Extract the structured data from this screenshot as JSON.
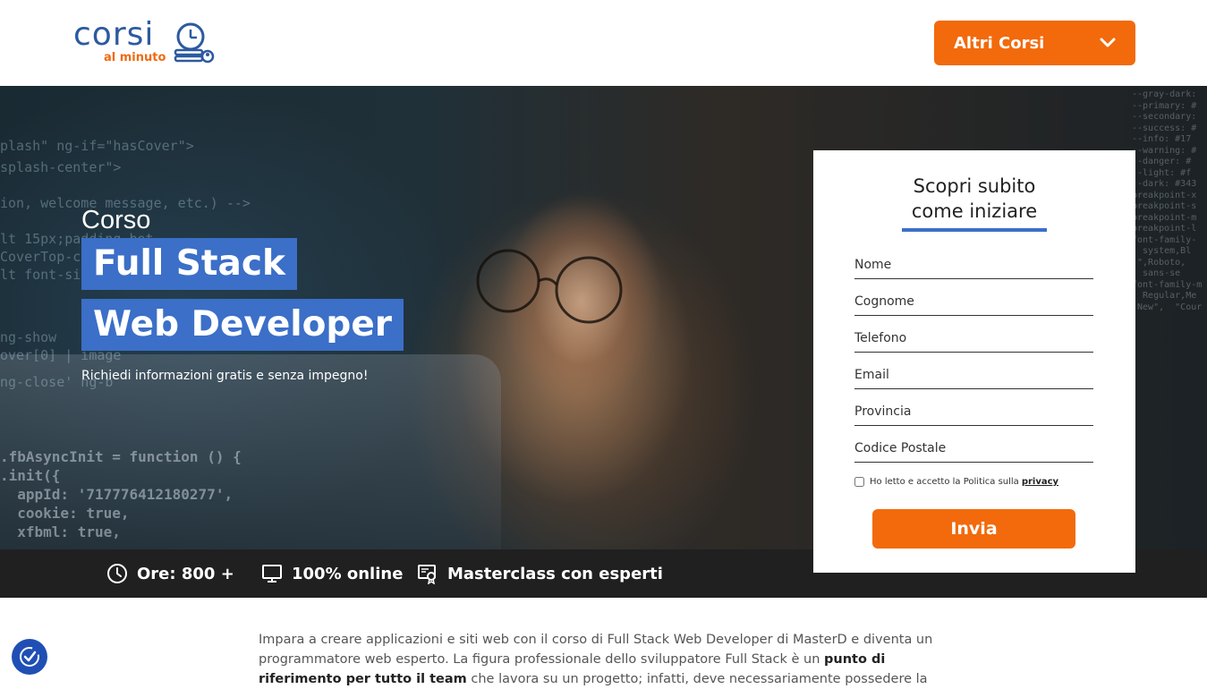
{
  "header": {
    "logo": {
      "word": "corsi",
      "sub": "al minuto"
    },
    "dropdown_label": "Altri Corsi"
  },
  "hero": {
    "prefix": "Corso",
    "title_line1": "Full Stack",
    "title_line2": "Web Developer",
    "subtitle": "Richiedi informazioni gratis e senza impegno!"
  },
  "stats": [
    {
      "icon": "clock-icon",
      "label": "Ore: 800 +"
    },
    {
      "icon": "monitor-icon",
      "label": "100% online"
    },
    {
      "icon": "certificate-icon",
      "label": "Masterclass con esperti"
    }
  ],
  "form": {
    "title_line1": "Scopri subito",
    "title_line2": "come iniziare",
    "fields": {
      "nome": "Nome",
      "cognome": "Cognome",
      "telefono": "Telefono",
      "email": "Email",
      "provincia": "Provincia",
      "cap": "Codice Postale"
    },
    "privacy_text": "Ho letto e accetto la Politica sulla",
    "privacy_link": "privacy",
    "submit_label": "Invia"
  },
  "intro": {
    "part1": "Impara a creare applicazioni e siti web con il corso di Full Stack Web Developer di MasterD e diventa un programmatore web esperto. La figura professionale dello sviluppatore Full Stack è un ",
    "bold": "punto di riferimento per tutto il team",
    "part2": " che lavora su un progetto; infatti, deve necessariamente possedere la"
  },
  "colors": {
    "accent_orange": "#f26a0c",
    "accent_blue": "#3b6fc8",
    "stats_bg": "#202020"
  }
}
